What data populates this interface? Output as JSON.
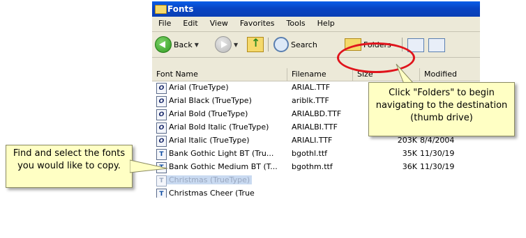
{
  "window": {
    "title": "Fonts"
  },
  "menu": [
    "File",
    "Edit",
    "View",
    "Favorites",
    "Tools",
    "Help"
  ],
  "toolbar": {
    "back": "Back",
    "search": "Search",
    "folders": "Folders"
  },
  "columns": [
    "Font Name",
    "Filename",
    "Size",
    "Modified"
  ],
  "fonts": [
    {
      "name": "Arial (TrueType)",
      "file": "ARIAL.TTF",
      "size": "",
      "modified": "",
      "icon": "O"
    },
    {
      "name": "Arial Black (TrueType)",
      "file": "ariblk.TTF",
      "size": "",
      "modified": "",
      "icon": "O"
    },
    {
      "name": "Arial Bold (TrueType)",
      "file": "ARIALBD.TTF",
      "size": "",
      "modified": "",
      "icon": "O"
    },
    {
      "name": "Arial Bold Italic (TrueType)",
      "file": "ARIALBI.TTF",
      "size": "",
      "modified": "",
      "icon": "O"
    },
    {
      "name": "Arial Italic (TrueType)",
      "file": "ARIALI.TTF",
      "size": "203K",
      "modified": "8/4/2004",
      "icon": "O"
    },
    {
      "name": "Bank Gothic Light BT (Tru...",
      "file": "bgothl.ttf",
      "size": "35K",
      "modified": "11/30/19",
      "icon": "T"
    },
    {
      "name": "Bank Gothic Medium BT (T...",
      "file": "bgothm.ttf",
      "size": "36K",
      "modified": "11/30/19",
      "icon": "T"
    },
    {
      "name": "Christmas (TrueType)",
      "file": "",
      "size": "",
      "modified": "",
      "icon": "T"
    },
    {
      "name": "Christmas Cheer (True",
      "file": "",
      "size": "",
      "modified": "",
      "icon": "T"
    }
  ],
  "callouts": {
    "folders_tip": "Click \"Folders\" to begin navigating to the destination (thumb drive)",
    "select_tip": "Find and select the fonts you would like to copy."
  }
}
